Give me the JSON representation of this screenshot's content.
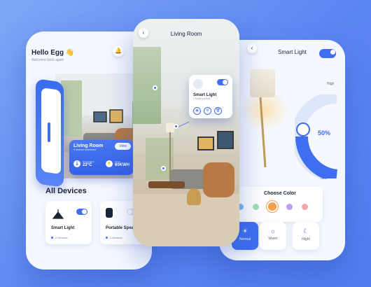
{
  "home": {
    "greeting": "Hello Egg 👋",
    "subtitle": "Welcome back again",
    "room_card": {
      "title": "Living Room",
      "subtitle": "9 devices connected",
      "view_label": "View",
      "temp_label": "Temperature",
      "temp_value": "22°C",
      "power_label": "Power",
      "power_value": "60KWH"
    },
    "section_title": "All Devices",
    "devices": [
      {
        "name": "Smart Light",
        "count": "2 Devices",
        "on": true
      },
      {
        "name": "Portable Speak",
        "count": "2 Devices",
        "on": false
      }
    ]
  },
  "ar_view": {
    "title": "Living Room",
    "popup": {
      "name": "Smart Light",
      "subtitle": "2 Mode controls"
    }
  },
  "light_detail": {
    "title": "Smart Light",
    "high_label": "High",
    "low_label": "Low",
    "brightness": "50%",
    "brightness_fraction": 0.5,
    "choose_color_label": "Choose Color",
    "colors": [
      "#7fb8f5",
      "#9fe0b4",
      "#f2a04a",
      "#b7a2f2",
      "#f2a6a6"
    ],
    "selected_color_index": 2,
    "modes": [
      {
        "label": "Normal",
        "active": true
      },
      {
        "label": "Warm",
        "active": false
      },
      {
        "label": "Night",
        "active": false
      }
    ]
  },
  "colors": {
    "accent": "#3f6ef0",
    "background": "#5b86f2"
  }
}
